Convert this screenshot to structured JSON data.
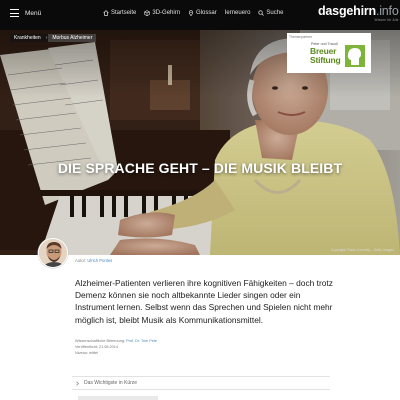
{
  "header": {
    "menu_label": "Menü",
    "nav": [
      {
        "label": "Startseite",
        "icon": "home-icon"
      },
      {
        "label": "3D-Gehirn",
        "icon": "cube-icon"
      },
      {
        "label": "Glossar",
        "icon": "location-pin-icon"
      },
      {
        "label": "Ierneuero",
        "icon": "none"
      },
      {
        "label": "Suche",
        "icon": "search-icon"
      }
    ],
    "logo": {
      "part1": "das",
      "part2": "gehirn",
      "part3": ".info",
      "tagline": "Wissen für Alle"
    }
  },
  "breadcrumb": [
    "Krankheiten",
    "Morbus Alzheimer"
  ],
  "sponsor": {
    "label": "Themenpartner",
    "line1": "Peter und Traudl",
    "line2": "Breuer",
    "line3": "Stiftung"
  },
  "hero": {
    "title": "DIE SPRACHE GEHT – DIE MUSIK BLEIBT",
    "copyright": "Copyright: Paula Connelly – Getty Images"
  },
  "author": {
    "prefix": "Autor:",
    "name": "Ulrich Pontes"
  },
  "teaser": "Alzheimer-Patienten verlieren ihre kognitiven Fähigkeiten – doch trotz Demenz können sie noch altbekannte Lieder singen oder ein Instrument lernen. Selbst wenn das Sprechen und Spielen nicht mehr möglich ist, bleibt Musik als Kommunikationsmittel.",
  "meta": {
    "review_prefix": "Wissenschaftliche Betreuung:",
    "reviewer": "Prof. Dr. Tom Pete",
    "published": "Veröffentlicht: 21.08.2014",
    "level": "Niveau: mittel"
  },
  "summary_toggle": "Das Wichtigste in Kürze",
  "colors": {
    "accent": "#4a8bc2",
    "sponsor_green": "#5c8a1e",
    "nav_bg": "#0a0a0a"
  }
}
